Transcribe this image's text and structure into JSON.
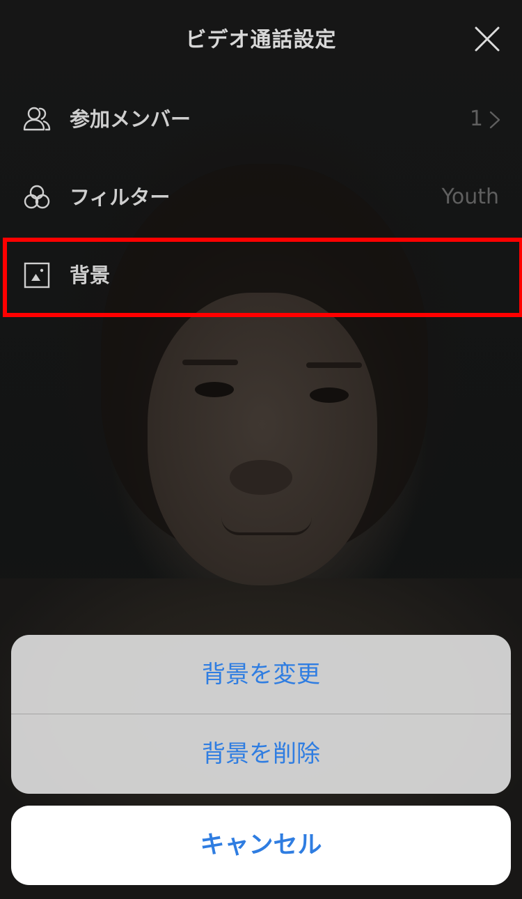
{
  "header": {
    "title": "ビデオ通話設定",
    "close_icon": "close-icon"
  },
  "menu": {
    "items": [
      {
        "label": "参加メンバー",
        "value": "1",
        "icon": "people-icon",
        "has_chevron": true
      },
      {
        "label": "フィルター",
        "value": "Youth",
        "icon": "filter-circles-icon"
      },
      {
        "label": "背景",
        "icon": "image-icon",
        "highlighted": true
      }
    ]
  },
  "action_sheet": {
    "change_label": "背景を変更",
    "delete_label": "背景を削除",
    "cancel_label": "キャンセル"
  },
  "colors": {
    "accent": "#2f7de1",
    "highlight": "#ff0000",
    "sheet_background": "#d4d4d4",
    "cancel_background": "#ffffff"
  }
}
